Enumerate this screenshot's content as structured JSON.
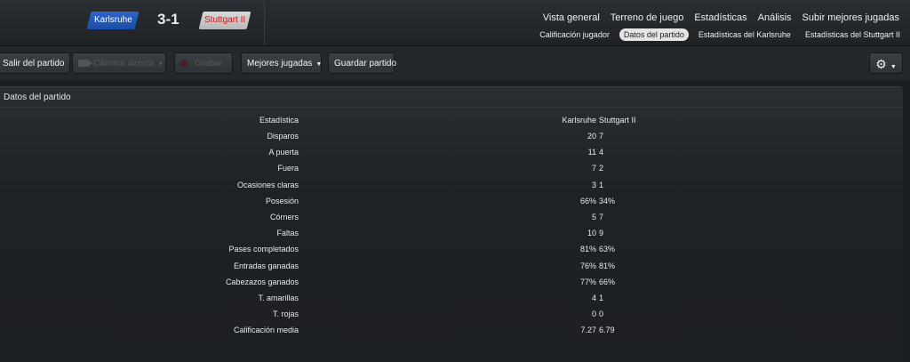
{
  "match": {
    "home_team": "Karlsruhe",
    "away_team": "Stuttgart II",
    "score": "3-1"
  },
  "nav": {
    "main": [
      "Vista general",
      "Terreno de juego",
      "Estadísticas",
      "Análisis",
      "Subir mejores jugadas"
    ],
    "sub": [
      "Calificación jugador",
      "Datos del partido",
      "Estadísticas del Karlsruhe",
      "Estadísticas del Stuttgart II"
    ],
    "active_sub": "Datos del partido"
  },
  "toolbar": {
    "exit_label": "Salir del partido",
    "camera_label": "Cámara directa",
    "record_label": "Grabar",
    "highlights_label": "Mejores jugadas",
    "save_label": "Guardar partido"
  },
  "panel": {
    "title": "Datos del partido"
  },
  "stats": {
    "header": {
      "label": "Estadística",
      "home": "Karlsruhe",
      "away": "Stuttgart II"
    },
    "rows": [
      {
        "label": "Disparos",
        "home": "20",
        "away": "7"
      },
      {
        "label": "A puerta",
        "home": "11",
        "away": "4"
      },
      {
        "label": "Fuera",
        "home": "7",
        "away": "2"
      },
      {
        "label": "Ocasiones claras",
        "home": "3",
        "away": "1"
      },
      {
        "label": "Posesión",
        "home": "66%",
        "away": "34%"
      },
      {
        "label": "Córners",
        "home": "5",
        "away": "7"
      },
      {
        "label": "Faltas",
        "home": "10",
        "away": "9"
      },
      {
        "label": "Pases completados",
        "home": "81%",
        "away": "63%"
      },
      {
        "label": "Entradas ganadas",
        "home": "76%",
        "away": "81%"
      },
      {
        "label": "Cabezazos ganados",
        "home": "77%",
        "away": "66%"
      },
      {
        "label": "T. amarillas",
        "home": "4",
        "away": "1"
      },
      {
        "label": "T. rojas",
        "home": "0",
        "away": "0"
      },
      {
        "label": "Calificación media",
        "home": "7.27",
        "away": "6.79"
      }
    ]
  }
}
